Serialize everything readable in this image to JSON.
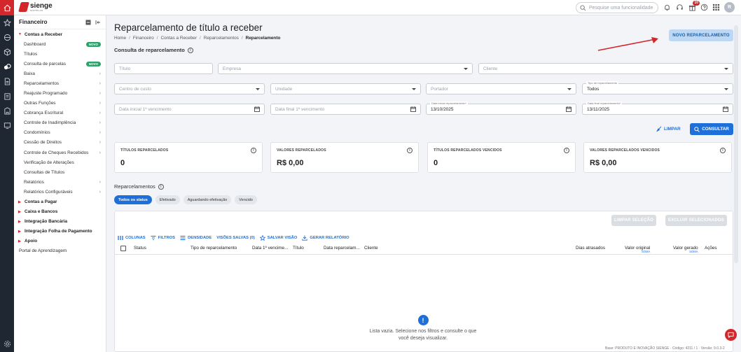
{
  "brand": {
    "name": "sienge",
    "sub": "SOFTPLAN"
  },
  "topbar": {
    "search_placeholder": "Pesquise uma funcionalidade",
    "notif_count": "10",
    "avatar_letter": "R"
  },
  "sidebar": {
    "title": "Financeiro",
    "section_open": "Contas a Receber",
    "items": [
      {
        "label": "Dashboard",
        "badge": "NOVO"
      },
      {
        "label": "Títulos"
      },
      {
        "label": "Consulta de parcelas",
        "badge": "NOVO"
      },
      {
        "label": "Baixa",
        "arrow": "›"
      },
      {
        "label": "Reparcelamentos",
        "arrow": "›"
      },
      {
        "label": "Reajuste Programado",
        "arrow": "›"
      },
      {
        "label": "Outras Funções",
        "arrow": "›"
      },
      {
        "label": "Cobrança Escritural",
        "arrow": "›"
      },
      {
        "label": "Controle de Inadimplência",
        "arrow": "›"
      },
      {
        "label": "Condomínios",
        "arrow": "›"
      },
      {
        "label": "Cessão de Direitos",
        "arrow": "›"
      },
      {
        "label": "Controle de Cheques Recebidos",
        "arrow": "›"
      },
      {
        "label": "Verificação de Alterações"
      },
      {
        "label": "Consultas de Títulos"
      },
      {
        "label": "Relatórios",
        "arrow": "›"
      },
      {
        "label": "Relatórios Configuráveis",
        "arrow": "›"
      }
    ],
    "groups": [
      "Contas a Pagar",
      "Caixa e Bancos",
      "Integração Bancária",
      "Integração Folha de Pagamento",
      "Apoio"
    ],
    "portal": "Portal de Aprendizagem"
  },
  "page": {
    "title": "Reparcelamento de título a receber",
    "breadcrumb": [
      "Home",
      "Financeiro",
      "Contas a Receber",
      "Reparcelamentos",
      "Reparcelamento"
    ],
    "subtitle": "Consulta de reparcelamento",
    "new_button": "NOVO REPARCELAMENTO"
  },
  "filters": {
    "titulo": "Título",
    "empresa": "Empresa",
    "cliente": "Cliente",
    "centro_custo": "Centro de custo",
    "unidade": "Unidade",
    "portador": "Portador",
    "tipo_label": "Tipo de reparcelamento",
    "tipo_value": "Todos",
    "data_ini_venc": "Data inicial 1º vencimento",
    "data_fim_venc": "Data final 1º vencimento",
    "data_ini_rep_label": "Data inicial reparcelamento*",
    "data_ini_rep_value": "13/10/2025",
    "data_fim_rep_label": "Data final reparcelamento*",
    "data_fim_rep_value": "13/11/2025",
    "limpar": "LIMPAR",
    "consultar": "CONSULTAR"
  },
  "cards": [
    {
      "title": "TÍTULOS REPARCELADOS",
      "value": "0"
    },
    {
      "title": "VALORES REPARCELADOS",
      "value": "R$ 0,00"
    },
    {
      "title": "TÍTULOS REPARCELADOS VENCIDOS",
      "value": "0"
    },
    {
      "title": "VALORES REPARCELADOS VENCIDOS",
      "value": "R$ 0,00"
    }
  ],
  "reparcelamentos": {
    "title": "Reparcelamentos",
    "chips": [
      "Todos os status",
      "Efetivado",
      "Aguardando efetivação",
      "Vencido"
    ]
  },
  "table": {
    "limpar_selecao": "LIMPAR SELEÇÃO",
    "excluir": "EXCLUIR SELECIONADOS",
    "tools": [
      "COLUNAS",
      "FILTROS",
      "DENSIDADE",
      "VISÕES SALVAS (0)",
      "SALVAR VISÃO",
      "GERAR RELATÓRIO"
    ],
    "headers": [
      "Status",
      "Tipo de reparcelamento",
      "Data 1º vencime...",
      "Título",
      "Data reparcelam...",
      "Cliente",
      "Dias atrasados",
      "Valor original",
      "Valor gerado",
      "Ações"
    ],
    "soma": "SOMA",
    "empty_line1": "Lista vazia. Selecione nos filtros e consulte o que",
    "empty_line2": "você deseja visualizar."
  },
  "footer": "Base: PRODUTO E INOVAÇÃO SIENGE · Código: 4211 / 1 · Versão: 9.0.3-2"
}
